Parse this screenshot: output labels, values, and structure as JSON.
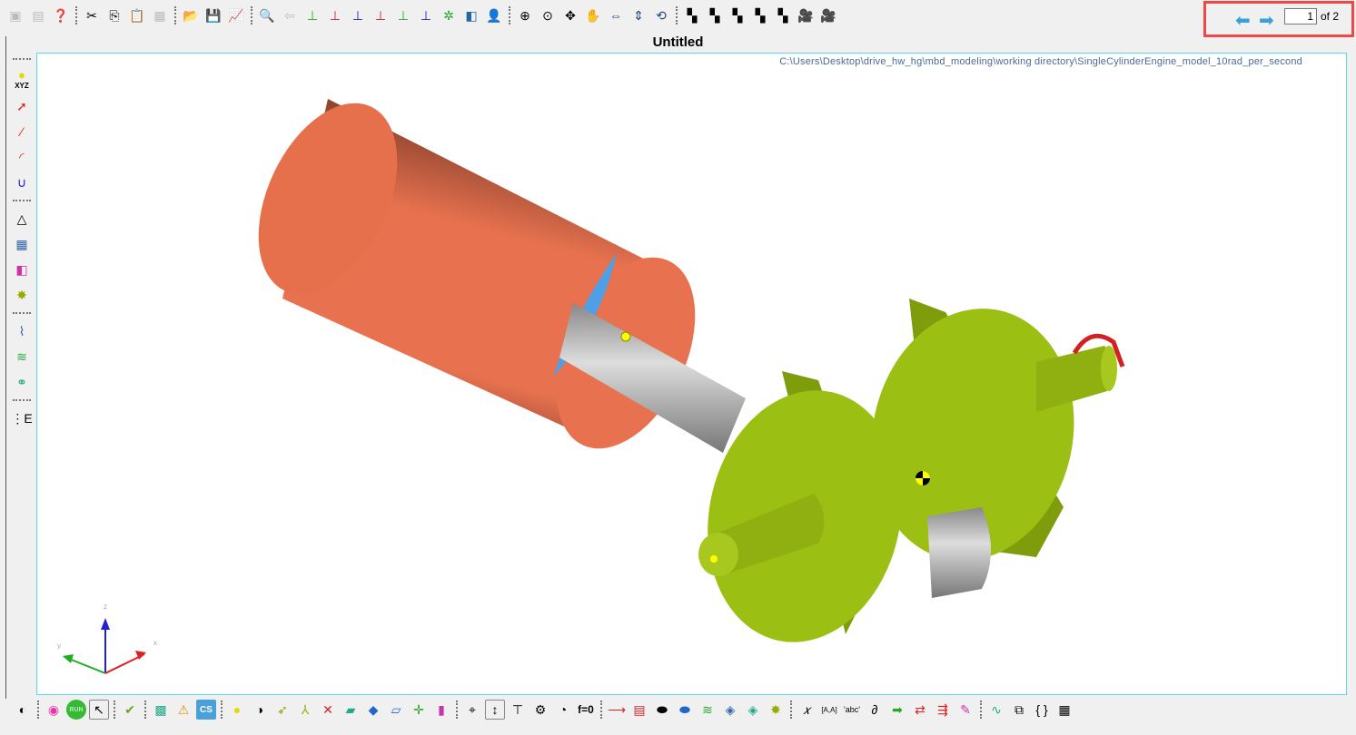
{
  "window": {
    "title": "Untitled"
  },
  "viewport": {
    "file_path": "C:\\Users\\Desktop\\drive_hw_hg\\mbd_modeling\\working directory\\SingleCylinderEngine_model_10rad_per_second"
  },
  "pager": {
    "current_page": "1",
    "total_label": "of 2"
  },
  "axis_labels": {
    "x": "x",
    "y": "y",
    "z": "z"
  },
  "left_toolbar": {
    "point_label": "XYZ"
  },
  "bottom_toolbar": {
    "run_label": "RUN",
    "cs_label": "CS",
    "feq_label": "f=0",
    "abc_label": "'abc'",
    "a_label": "[A,A]",
    "braces_label": "{ }"
  },
  "colors": {
    "cylinder": "#e8724f",
    "flywheel": "#8fb010",
    "shaft": "#b8b8b8",
    "accent": "#3aa0d8"
  }
}
